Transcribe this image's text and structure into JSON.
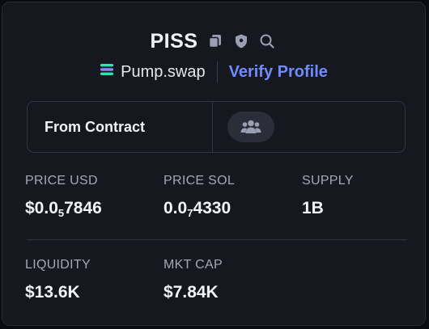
{
  "token": {
    "symbol": "PISS",
    "icons": [
      "copy-icon",
      "shield-icon",
      "search-icon"
    ]
  },
  "source": {
    "icon": "pump-swap-logo-icon",
    "name": "Pump.swap",
    "verify_label": "Verify Profile"
  },
  "contract_box": {
    "label": "From Contract",
    "community_icon": "users-icon"
  },
  "stats": {
    "price_usd": {
      "label": "PRICE USD",
      "prefix": "$0.0",
      "zeros": "5",
      "digits": "7846"
    },
    "price_sol": {
      "label": "PRICE SOL",
      "prefix": "0.0",
      "zeros": "7",
      "digits": "4330"
    },
    "supply": {
      "label": "SUPPLY",
      "value": "1B"
    },
    "liquidity": {
      "label": "LIQUIDITY",
      "value": "$13.6K"
    },
    "mkt_cap": {
      "label": "MKT CAP",
      "value": "$7.84K"
    }
  },
  "colors": {
    "background": "#16171f",
    "accent_link": "#6f8cff",
    "label_gray": "#a4a7b6",
    "text_white": "#f4f5f8"
  }
}
